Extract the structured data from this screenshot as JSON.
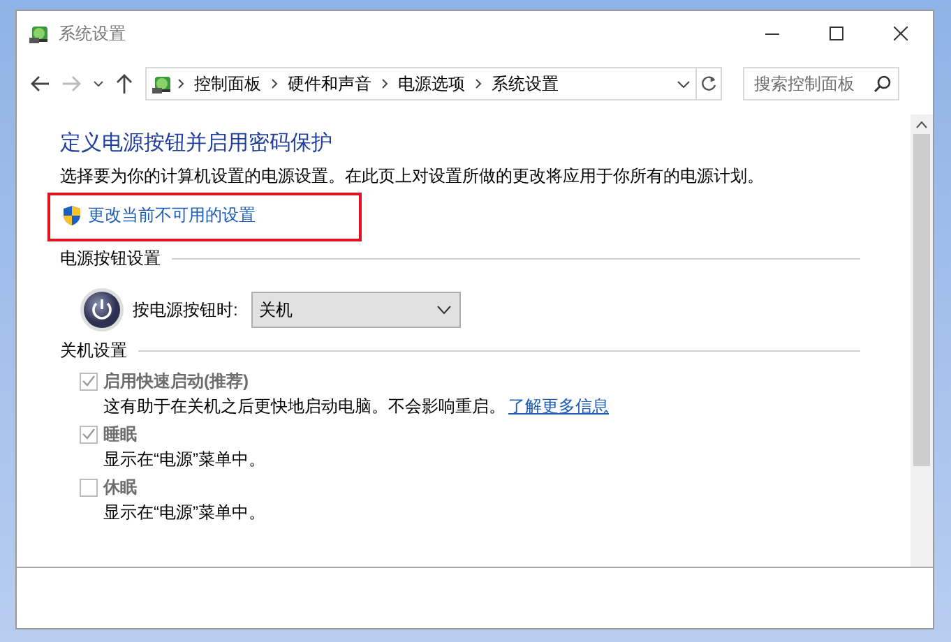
{
  "window": {
    "title": "系统设置"
  },
  "nav": {
    "back_disabled": false,
    "forward_disabled": true
  },
  "breadcrumbs": [
    "控制面板",
    "硬件和声音",
    "电源选项",
    "系统设置"
  ],
  "search": {
    "placeholder": "搜索控制面板"
  },
  "heading": "定义电源按钮并启用密码保护",
  "description": "选择要为你的计算机设置的电源设置。在此页上对设置所做的更改将应用于你所有的电源计划。",
  "admin_link": {
    "label": "更改当前不可用的设置",
    "highlighted": true
  },
  "power_button_section": {
    "title": "电源按钮设置",
    "label": "按电源按钮时:",
    "value": "关机"
  },
  "shutdown_section": {
    "title": "关机设置",
    "options": [
      {
        "label": "启用快速启动(推荐)",
        "checked": true,
        "disabled": true,
        "description": "这有助于在关机之后更快地启动电脑。不会影响重启。",
        "link": "了解更多信息"
      },
      {
        "label": "睡眠",
        "checked": true,
        "disabled": true,
        "description": "显示在“电源”菜单中。"
      },
      {
        "label": "休眠",
        "checked": false,
        "disabled": true,
        "description": "显示在“电源”菜单中。"
      }
    ]
  }
}
